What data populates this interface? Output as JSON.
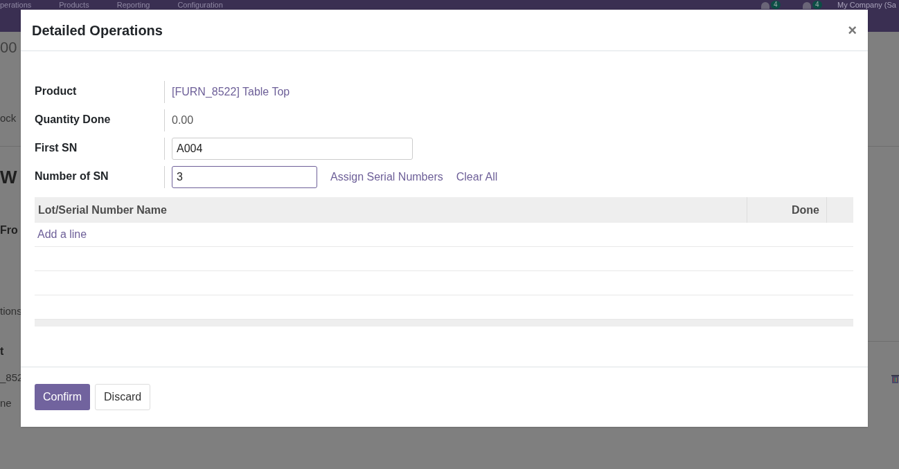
{
  "background": {
    "nav_items": [
      "perations",
      "Products",
      "Reporting",
      "Configuration"
    ],
    "badges": [
      "4",
      "4"
    ],
    "company": "My Company (Sa",
    "fragments": [
      {
        "text": "00",
        "kind": "title"
      },
      {
        "text": "ock",
        "kind": "plain"
      },
      {
        "text": "W",
        "kind": "heading"
      },
      {
        "text": "Fro",
        "kind": "label"
      },
      {
        "text": "tions",
        "kind": "plain"
      },
      {
        "text": "t",
        "kind": "label"
      },
      {
        "text": "_852",
        "kind": "plain"
      },
      {
        "text": "ne",
        "kind": "plain"
      }
    ]
  },
  "dialog": {
    "title": "Detailed Operations",
    "close": "×",
    "fields": [
      {
        "label": "Product",
        "kind": "link",
        "value": "[FURN_8522] Table Top"
      },
      {
        "label": "Quantity Done",
        "kind": "text",
        "value": "0.00"
      },
      {
        "label": "First SN",
        "kind": "input",
        "value": "A004",
        "focused": false
      },
      {
        "label": "Number of SN",
        "kind": "input",
        "value": "3",
        "focused": true
      }
    ],
    "actions": [
      "Assign Serial Numbers",
      "Clear All"
    ],
    "table": {
      "columns": [
        "Lot/Serial Number Name",
        "Done"
      ],
      "add_line": "Add a line"
    },
    "buttons": [
      {
        "label": "Confirm",
        "primary": true
      },
      {
        "label": "Discard",
        "primary": false
      }
    ]
  }
}
